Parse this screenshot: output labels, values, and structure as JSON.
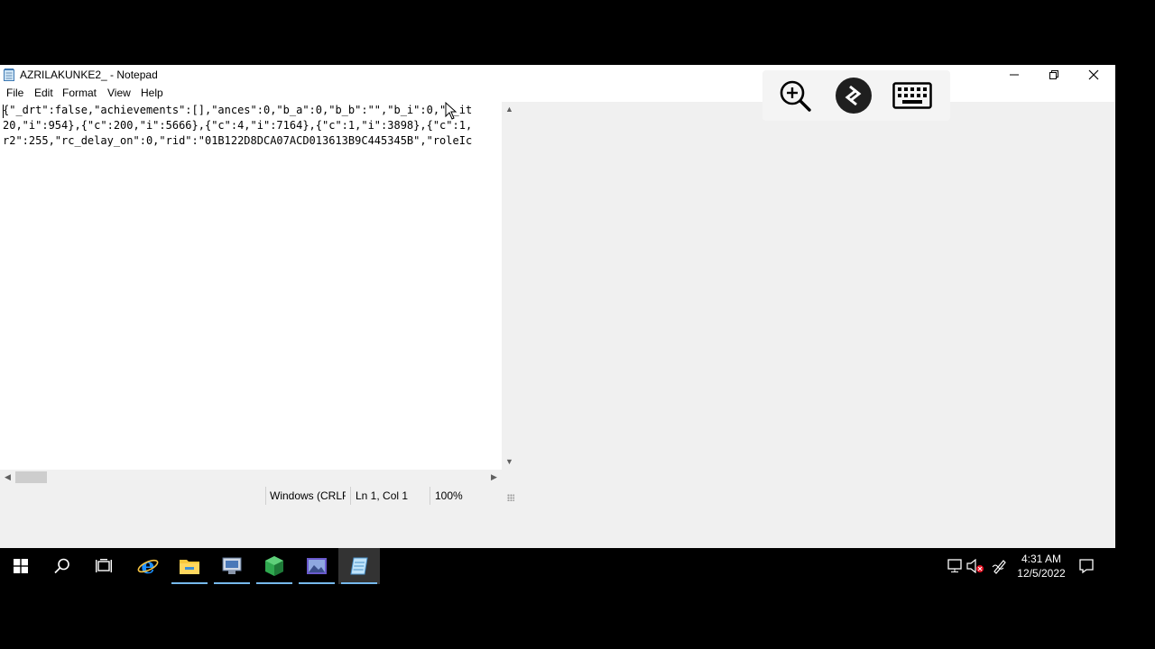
{
  "window": {
    "title": "AZRILAKUNKE2_ - Notepad",
    "minimize_glyph": "─",
    "restore_glyph": "❐",
    "close_glyph": "✕"
  },
  "menu": {
    "items": [
      {
        "label": "File"
      },
      {
        "label": "Edit"
      },
      {
        "label": "Format"
      },
      {
        "label": "View"
      },
      {
        "label": "Help"
      }
    ]
  },
  "editor": {
    "lines": [
      "{\"_drt\":false,\"achievements\":[],\"ances\":0,\"b_a\":0,\"b_b\":\"\",\"b_i\":0,\"b_it",
      "20,\"i\":954},{\"c\":200,\"i\":5666},{\"c\":4,\"i\":7164},{\"c\":1,\"i\":3898},{\"c\":1,",
      "r2\":255,\"rc_delay_on\":0,\"rid\":\"01B122D8DCA07ACD013613B9C445345B\",\"roleIc"
    ]
  },
  "status": {
    "line_ending": "Windows (CRLF)",
    "position": "Ln 1, Col 1",
    "zoom": "100%"
  },
  "rdp_toolbar": {
    "icons": [
      "zoom-in-icon",
      "remote-desktop-icon",
      "keyboard-icon"
    ]
  },
  "taskbar": {
    "apps": [
      "start-icon",
      "search-icon",
      "task-view-icon",
      "internet-explorer-icon",
      "file-explorer-icon",
      "app-icon",
      "cube-app-icon",
      "image-app-icon",
      "notepad-icon"
    ],
    "clock_time": "4:31 AM",
    "clock_date": "12/5/2022",
    "tray": [
      "network-icon",
      "volume-muted-icon",
      "pen-icon",
      "notification-icon"
    ],
    "accent_color": "#76b9ed"
  }
}
